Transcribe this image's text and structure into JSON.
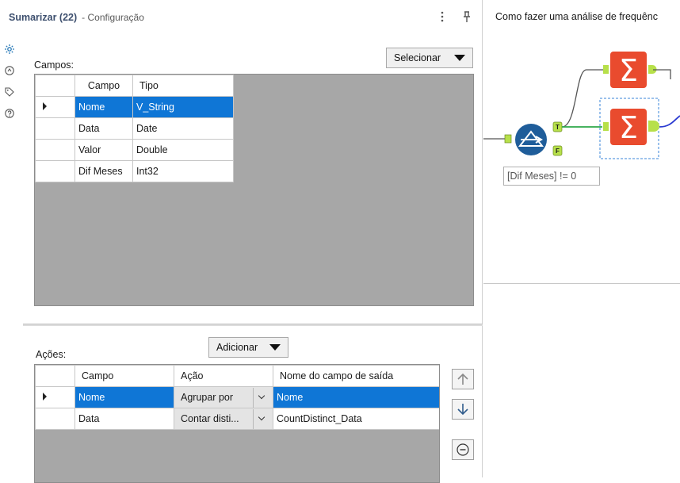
{
  "panel": {
    "title": "Sumarizar (22)",
    "subtitle": "- Configuração"
  },
  "sidebar": {
    "icons": [
      "gear-icon",
      "refresh-icon",
      "tag-icon",
      "help-icon"
    ]
  },
  "fields": {
    "label": "Campos:",
    "select_label": "Selecionar",
    "columns": [
      "Campo",
      "Tipo"
    ],
    "rows": [
      {
        "campo": "Nome",
        "tipo": "V_String"
      },
      {
        "campo": "Data",
        "tipo": "Date"
      },
      {
        "campo": "Valor",
        "tipo": "Double"
      },
      {
        "campo": "Dif Meses",
        "tipo": "Int32"
      }
    ]
  },
  "actions": {
    "label": "Ações:",
    "add_label": "Adicionar",
    "columns": [
      "Campo",
      "Ação",
      "Nome do campo de saída"
    ],
    "rows": [
      {
        "campo": "Nome",
        "acao": "Agrupar por",
        "saida": "Nome"
      },
      {
        "campo": "Data",
        "acao": "Contar disti...",
        "saida": "CountDistinct_Data"
      }
    ],
    "buttons": [
      "move-up-icon",
      "move-down-icon",
      "remove-icon"
    ]
  },
  "canvas": {
    "title": "Como fazer uma análise de frequênc",
    "filter_annotation": "[Dif Meses] != 0",
    "anchor_true": "T",
    "anchor_false": "F"
  },
  "colors": {
    "selection": "#0f76d6",
    "summarize_tool": "#e94b2e",
    "filter_tool": "#1f5d9a",
    "connector_green": "#2ea84a",
    "connector_blue": "#2b3bd1",
    "anchor_green": "#b7e04a"
  }
}
